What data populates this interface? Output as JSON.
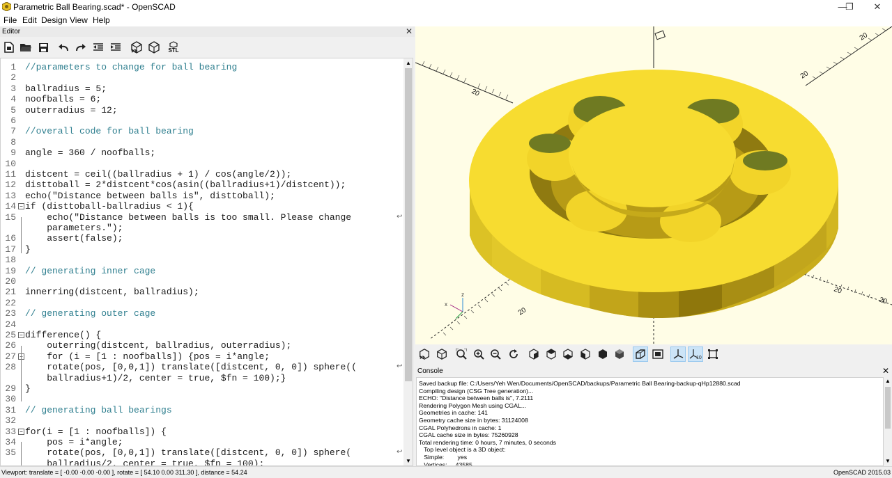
{
  "window": {
    "title": "Parametric Ball Bearing.scad* - OpenSCAD",
    "controls": [
      "—",
      "❐",
      "✕"
    ]
  },
  "menu": [
    "File",
    "Edit",
    "Design",
    "View",
    "Help"
  ],
  "editor": {
    "title": "Editor",
    "close": "✕",
    "toolbar": [
      "new-icon",
      "open-icon",
      "save-icon",
      "undo-icon",
      "redo-icon",
      "unindent-icon",
      "indent-icon",
      "preview-icon",
      "render-icon",
      "export-stl-icon"
    ],
    "stl_label": "STL",
    "lines": [
      {
        "n": "1",
        "t": "//parameters to change for ball bearing",
        "c": "cm"
      },
      {
        "n": "2",
        "t": ""
      },
      {
        "n": "3",
        "t": "ballradius = 5;"
      },
      {
        "n": "4",
        "t": "noofballs = 6;"
      },
      {
        "n": "5",
        "t": "outerradius = 12;"
      },
      {
        "n": "6",
        "t": ""
      },
      {
        "n": "7",
        "t": "//overall code for ball bearing",
        "c": "cm"
      },
      {
        "n": "8",
        "t": ""
      },
      {
        "n": "9",
        "t": "angle = 360 / noofballs;"
      },
      {
        "n": "10",
        "t": ""
      },
      {
        "n": "11",
        "t": "distcent = ceil((ballradius + 1) / cos(angle/2));"
      },
      {
        "n": "12",
        "t": "disttoball = 2*distcent*cos(asin((ballradius+1)/distcent));"
      },
      {
        "n": "13",
        "t": "echo(\"Distance between balls is\", disttoball);"
      },
      {
        "n": "14",
        "t": "if (disttoball-ballradius < 1){"
      },
      {
        "n": "15",
        "t": "    echo(\"Distance between balls is too small. Please change",
        "w": true
      },
      {
        "n": "",
        "t": "    parameters.\");"
      },
      {
        "n": "16",
        "t": "    assert(false);"
      },
      {
        "n": "17",
        "t": "}"
      },
      {
        "n": "18",
        "t": ""
      },
      {
        "n": "19",
        "t": "// generating inner cage",
        "c": "cm"
      },
      {
        "n": "20",
        "t": ""
      },
      {
        "n": "21",
        "t": "innerring(distcent, ballradius);"
      },
      {
        "n": "22",
        "t": ""
      },
      {
        "n": "23",
        "t": "// generating outer cage",
        "c": "cm"
      },
      {
        "n": "24",
        "t": ""
      },
      {
        "n": "25",
        "t": "difference() {"
      },
      {
        "n": "26",
        "t": "    outerring(distcent, ballradius, outerradius);"
      },
      {
        "n": "27",
        "t": "    for (i = [1 : noofballs]) {pos = i*angle;"
      },
      {
        "n": "28",
        "t": "    rotate(pos, [0,0,1]) translate([distcent, 0, 0]) sphere((",
        "w": true
      },
      {
        "n": "",
        "t": "    ballradius+1)/2, center = true, $fn = 100);}"
      },
      {
        "n": "29",
        "t": "}"
      },
      {
        "n": "30",
        "t": ""
      },
      {
        "n": "31",
        "t": "// generating ball bearings",
        "c": "cm"
      },
      {
        "n": "32",
        "t": ""
      },
      {
        "n": "33",
        "t": "for(i = [1 : noofballs]) {"
      },
      {
        "n": "34",
        "t": "    pos = i*angle;"
      },
      {
        "n": "35",
        "t": "    rotate(pos, [0,0,1]) translate([distcent, 0, 0]) sphere(",
        "w": true
      },
      {
        "n": "",
        "t": "    ballradius/2, center = true, $fn = 100);"
      }
    ]
  },
  "viewport": {
    "axis_labels": [
      "20",
      "20",
      "20",
      "20",
      "20",
      "20"
    ],
    "gizmo_z": "z",
    "gizmo_x": "x"
  },
  "viewbar": [
    "preview-icon",
    "render-icon",
    "view-all-icon",
    "zoom-in-icon",
    "zoom-out-icon",
    "reset-view-icon",
    "right-view-icon",
    "top-view-icon",
    "bottom-view-icon",
    "left-view-icon",
    "front-view-icon",
    "back-view-icon",
    "perspective-icon",
    "orthogonal-icon",
    "show-axes-icon",
    "show-scale-icon",
    "show-edges-icon"
  ],
  "console": {
    "title": "Console",
    "close": "✕",
    "lines": [
      "Saved backup file: C:/Users/Yeh Wen/Documents/OpenSCAD/backups/Parametric Ball Bearing-backup-qHp12880.scad",
      "Compiling design (CSG Tree generation)...",
      "ECHO: \"Distance between balls is\", 7.2111",
      "Rendering Polygon Mesh using CGAL...",
      "Geometries in cache: 141",
      "Geometry cache size in bytes: 31124008",
      "CGAL Polyhedrons in cache: 1",
      "CGAL cache size in bytes: 75260928",
      "Total rendering time: 0 hours, 7 minutes, 0 seconds",
      "   Top level object is a 3D object:",
      "   Simple:        yes",
      "   Vertices:     43585"
    ]
  },
  "status": {
    "left": "Viewport: translate = [ -0.00 -0.00 -0.00 ], rotate = [ 54.10 0.00 311.30 ], distance = 54.24",
    "right": "OpenSCAD 2015.03"
  }
}
